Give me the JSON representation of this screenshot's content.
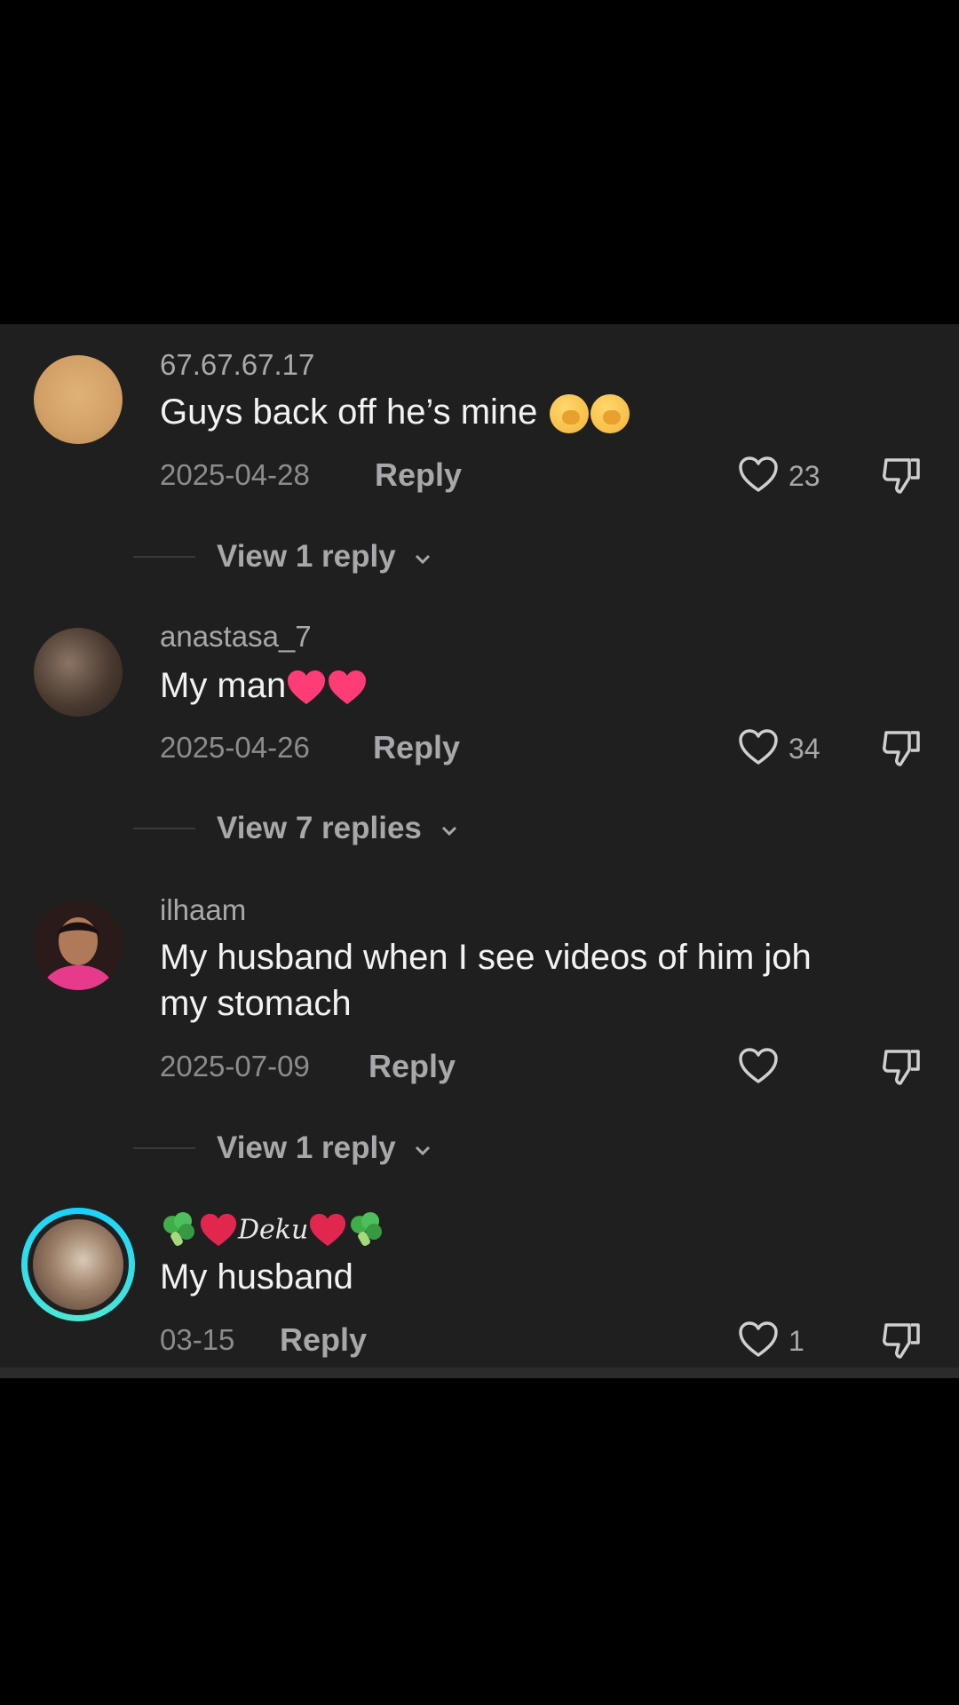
{
  "comments": [
    {
      "username": "67.67.67.17",
      "text": "Guys back off he’s mine",
      "date": "2025-04-28",
      "reply_label": "Reply",
      "likes": "23",
      "view_replies": "View 1 reply"
    },
    {
      "username": "anastasa_7",
      "text": "My man",
      "date": "2025-04-26",
      "reply_label": "Reply",
      "likes": "34",
      "view_replies": "View 7 replies"
    },
    {
      "username": "ilhaam",
      "text_line1": "My husband when I see videos of him joh",
      "text_line2": "my stomach",
      "date": "2025-07-09",
      "reply_label": "Reply",
      "likes": "",
      "view_replies": "View 1 reply"
    },
    {
      "username": "Deku",
      "text": "My husband",
      "date": "03-15",
      "reply_label": "Reply",
      "likes": "1"
    }
  ],
  "colors": {
    "panel_bg": "#1f1f20",
    "story_ring": "#17d2ff",
    "heart_emoji": "#ff3c76"
  }
}
